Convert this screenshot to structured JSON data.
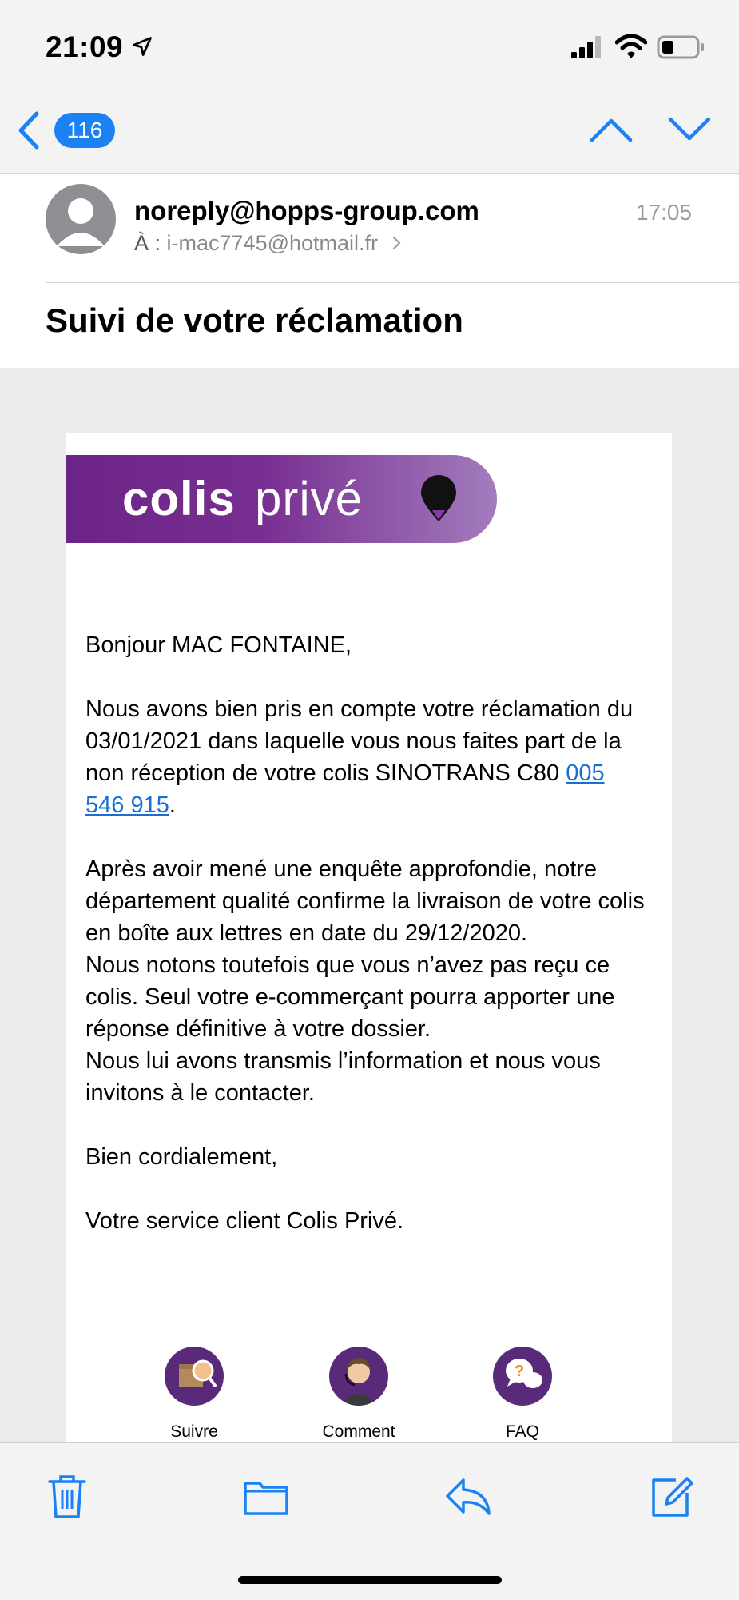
{
  "status_bar": {
    "time": "21:09"
  },
  "nav": {
    "unread_count": "116"
  },
  "mail": {
    "sender": "noreply@hopps-group.com",
    "to_label": "À :",
    "recipient": "i-mac7745@hotmail.fr",
    "time": "17:05",
    "subject": "Suivi de votre réclamation"
  },
  "body": {
    "brand_bold": "colis",
    "brand_light": "privé",
    "greeting": "Bonjour MAC FONTAINE,",
    "p1_text": "Nous avons bien pris en compte votre réclamation du 03/01/2021 dans laquelle vous nous faites part de la non réception de votre colis SINOTRANS C80 ",
    "tracking_link": "005 546 915",
    "p1_end": ".",
    "p2_line1": "Après avoir mené une enquête approfondie, notre département qualité confirme la livraison de votre colis en boîte aux lettres en date du 29/12/2020.",
    "p2_line2": "Nous notons toutefois que vous n’avez pas reçu ce colis. Seul votre e-commerçant pourra apporter une réponse définitive à votre dossier.",
    "p2_line3": "Nous lui avons transmis l’information et nous vous invitons à le contacter.",
    "closing": "Bien cordialement,",
    "signature": "Votre service client Colis Privé.",
    "footer_links": [
      {
        "label": "Suivre",
        "icon": "package-search-icon"
      },
      {
        "label": "Comment",
        "icon": "support-agent-icon"
      },
      {
        "label": "FAQ",
        "icon": "faq-bubble-icon"
      }
    ]
  },
  "toolbar": {
    "icons": [
      "trash-icon",
      "folder-icon",
      "reply-icon",
      "compose-icon"
    ]
  },
  "colors": {
    "accent": "#1b82f5",
    "brand": "#6b2586",
    "link": "#1b6fd1"
  }
}
